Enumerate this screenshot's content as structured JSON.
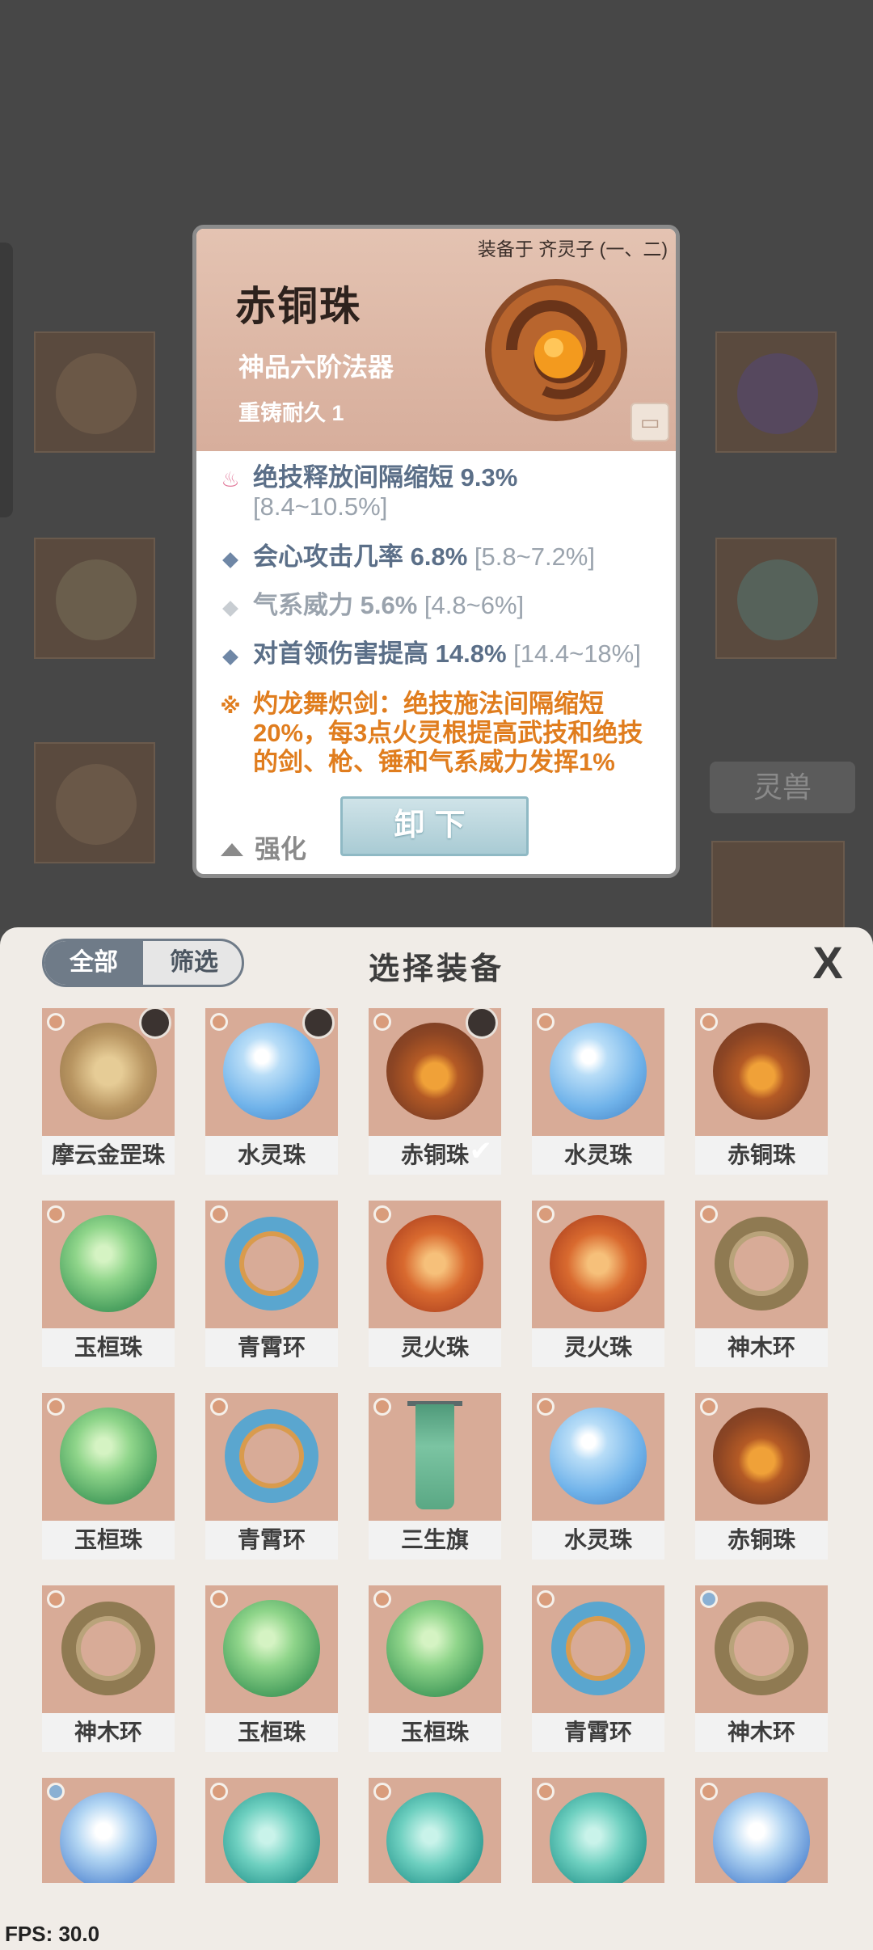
{
  "background": {
    "side_tab_label": "灵兽"
  },
  "popup": {
    "equipped_on": "装备于 齐灵子 (一、二)",
    "item_name": "赤铜珠",
    "item_grade": "神品六阶法器",
    "recast": "重铸耐久 1",
    "lock_icon": "lock-icon",
    "stats": [
      {
        "icon": "flame-icon",
        "text": "绝技释放间隔缩短 9.3%",
        "range": "[8.4~10.5%]"
      },
      {
        "icon": "diamond-icon",
        "text": "会心攻击几率 6.8%",
        "range": "[5.8~7.2%]"
      },
      {
        "icon": "diamond-light-icon",
        "text": "气系威力 5.6%",
        "range": "[4.8~6%]"
      },
      {
        "icon": "diamond-icon",
        "text": "对首领伤害提高 14.8%",
        "range": "[14.4~18%]"
      }
    ],
    "special": {
      "icon": "special-rune-icon",
      "text": "灼龙舞炽剑：绝技施法间隔缩短20%，每3点火灵根提高武技和绝技的剑、枪、锤和气系威力发挥1%"
    },
    "upgrade_label": "强化",
    "unequip_label": "卸下"
  },
  "panel": {
    "tabs": [
      {
        "label": "全部",
        "active": true
      },
      {
        "label": "筛选",
        "active": false
      }
    ],
    "title": "选择装备",
    "close_label": "X"
  },
  "items": [
    {
      "name": "摩云金罡珠",
      "art": "golden",
      "avatar": true
    },
    {
      "name": "水灵珠",
      "art": "water",
      "avatar": true
    },
    {
      "name": "赤铜珠",
      "art": "copper",
      "avatar": true,
      "selected": true
    },
    {
      "name": "水灵珠",
      "art": "water"
    },
    {
      "name": "赤铜珠",
      "art": "copper"
    },
    {
      "name": "玉桓珠",
      "art": "jade"
    },
    {
      "name": "青霄环",
      "art": "ring-blue"
    },
    {
      "name": "灵火珠",
      "art": "fire"
    },
    {
      "name": "灵火珠",
      "art": "fire"
    },
    {
      "name": "神木环",
      "art": "ring-wood"
    },
    {
      "name": "玉桓珠",
      "art": "jade"
    },
    {
      "name": "青霄环",
      "art": "ring-blue"
    },
    {
      "name": "三生旗",
      "art": "banner"
    },
    {
      "name": "水灵珠",
      "art": "water"
    },
    {
      "name": "赤铜珠",
      "art": "copper"
    },
    {
      "name": "神木环",
      "art": "ring-wood"
    },
    {
      "name": "玉桓珠",
      "art": "jade"
    },
    {
      "name": "玉桓珠",
      "art": "jade"
    },
    {
      "name": "青霄环",
      "art": "ring-blue"
    },
    {
      "name": "神木环",
      "art": "ring-wood",
      "badge": "blue"
    },
    {
      "name": "",
      "art": "icewater",
      "badge": "blue"
    },
    {
      "name": "",
      "art": "teal"
    },
    {
      "name": "",
      "art": "teal"
    },
    {
      "name": "",
      "art": "teal"
    },
    {
      "name": "",
      "art": "icewater"
    }
  ],
  "fps": "FPS: 30.0"
}
